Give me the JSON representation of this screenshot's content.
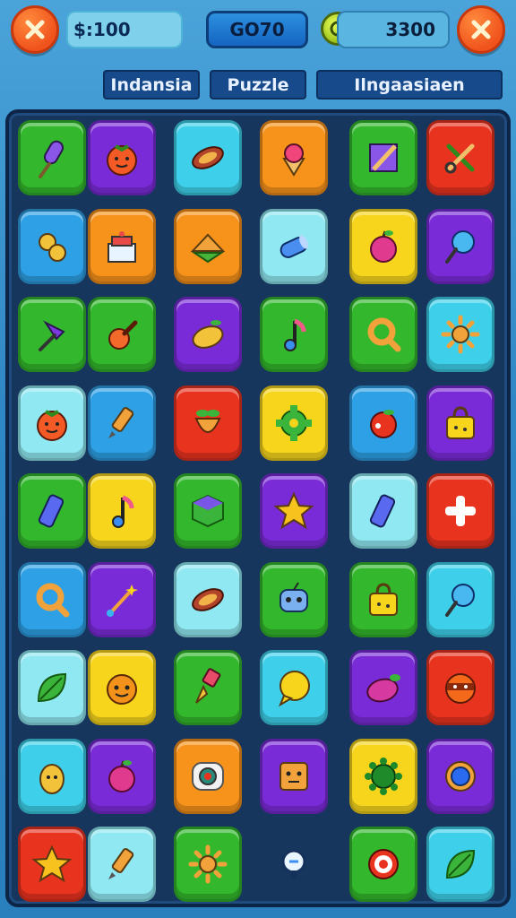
{
  "header": {
    "coins": "$:100",
    "center_label": "GO70",
    "gems": "3300"
  },
  "tabs": [
    {
      "label": "Indansia"
    },
    {
      "label": "Puzzle"
    },
    {
      "label": "Ilngaasiaen"
    }
  ],
  "colors": {
    "green": "#33b72d",
    "purple": "#7a2bd8",
    "cyan": "#3ed0ea",
    "orange": "#f7921a",
    "red": "#e8331f",
    "yellow": "#f7d51d",
    "blue": "#2ea0e6",
    "lightcyan": "#8fe8f2"
  },
  "grid": {
    "rows": [
      [
        {
          "color": "green",
          "icon": "popsicle-icon"
        },
        {
          "color": "purple",
          "icon": "tomato-face-icon"
        },
        {
          "color": "cyan",
          "icon": "sweet-potato-icon"
        },
        {
          "color": "orange",
          "icon": "ice-cream-icon"
        },
        {
          "color": "green",
          "icon": "pencil-note-icon"
        },
        {
          "color": "red",
          "icon": "scissors-icon"
        }
      ],
      [
        {
          "color": "blue",
          "icon": "peanut-icon"
        },
        {
          "color": "orange",
          "icon": "cake-box-icon"
        },
        {
          "color": "orange",
          "icon": "sandwich-icon"
        },
        {
          "color": "lightcyan",
          "icon": "pipe-icon"
        },
        {
          "color": "yellow",
          "icon": "apple-icon"
        },
        {
          "color": "purple",
          "icon": "lollipop-icon"
        }
      ],
      [
        {
          "color": "green",
          "icon": "umbrella-pin-icon"
        },
        {
          "color": "green",
          "icon": "guitar-icon"
        },
        {
          "color": "purple",
          "icon": "mango-icon"
        },
        {
          "color": "green",
          "icon": "music-note-icon"
        },
        {
          "color": "green",
          "icon": "magnifier-icon"
        },
        {
          "color": "cyan",
          "icon": "sun-icon"
        }
      ],
      [
        {
          "color": "lightcyan",
          "icon": "tomato-face-icon"
        },
        {
          "color": "blue",
          "icon": "pencil-icon"
        },
        {
          "color": "red",
          "icon": "strawberry-icon"
        },
        {
          "color": "yellow",
          "icon": "gear-icon"
        },
        {
          "color": "blue",
          "icon": "berry-icon"
        },
        {
          "color": "purple",
          "icon": "bag-icon"
        }
      ],
      [
        {
          "color": "green",
          "icon": "battery-icon"
        },
        {
          "color": "yellow",
          "icon": "music-note-icon"
        },
        {
          "color": "green",
          "icon": "cube-icon"
        },
        {
          "color": "purple",
          "icon": "star-icon"
        },
        {
          "color": "lightcyan",
          "icon": "battery-icon"
        },
        {
          "color": "red",
          "icon": "cross-icon"
        }
      ],
      [
        {
          "color": "blue",
          "icon": "magnifier-icon"
        },
        {
          "color": "purple",
          "icon": "wand-icon"
        },
        {
          "color": "lightcyan",
          "icon": "sweet-potato-icon"
        },
        {
          "color": "green",
          "icon": "robot-face-icon"
        },
        {
          "color": "green",
          "icon": "bag-icon"
        },
        {
          "color": "cyan",
          "icon": "lollipop-icon"
        }
      ],
      [
        {
          "color": "lightcyan",
          "icon": "leaf-icon"
        },
        {
          "color": "yellow",
          "icon": "pumpkin-face-icon"
        },
        {
          "color": "green",
          "icon": "paintbrush-icon"
        },
        {
          "color": "cyan",
          "icon": "speech-bubble-icon"
        },
        {
          "color": "purple",
          "icon": "eggplant-icon"
        },
        {
          "color": "red",
          "icon": "ninja-face-icon"
        }
      ],
      [
        {
          "color": "cyan",
          "icon": "pear-face-icon"
        },
        {
          "color": "purple",
          "icon": "apple-icon"
        },
        {
          "color": "orange",
          "icon": "donut-icon"
        },
        {
          "color": "purple",
          "icon": "box-face-icon"
        },
        {
          "color": "yellow",
          "icon": "virus-icon"
        },
        {
          "color": "purple",
          "icon": "ring-icon"
        }
      ],
      [
        {
          "color": "red",
          "icon": "star-icon"
        },
        {
          "color": "lightcyan",
          "icon": "pencil-icon"
        },
        {
          "color": "green",
          "icon": "sun-icon"
        },
        {
          "color": "none",
          "icon": "compass-pin-icon"
        },
        {
          "color": "green",
          "icon": "target-icon"
        },
        {
          "color": "cyan",
          "icon": "leaf-icon"
        }
      ]
    ]
  }
}
